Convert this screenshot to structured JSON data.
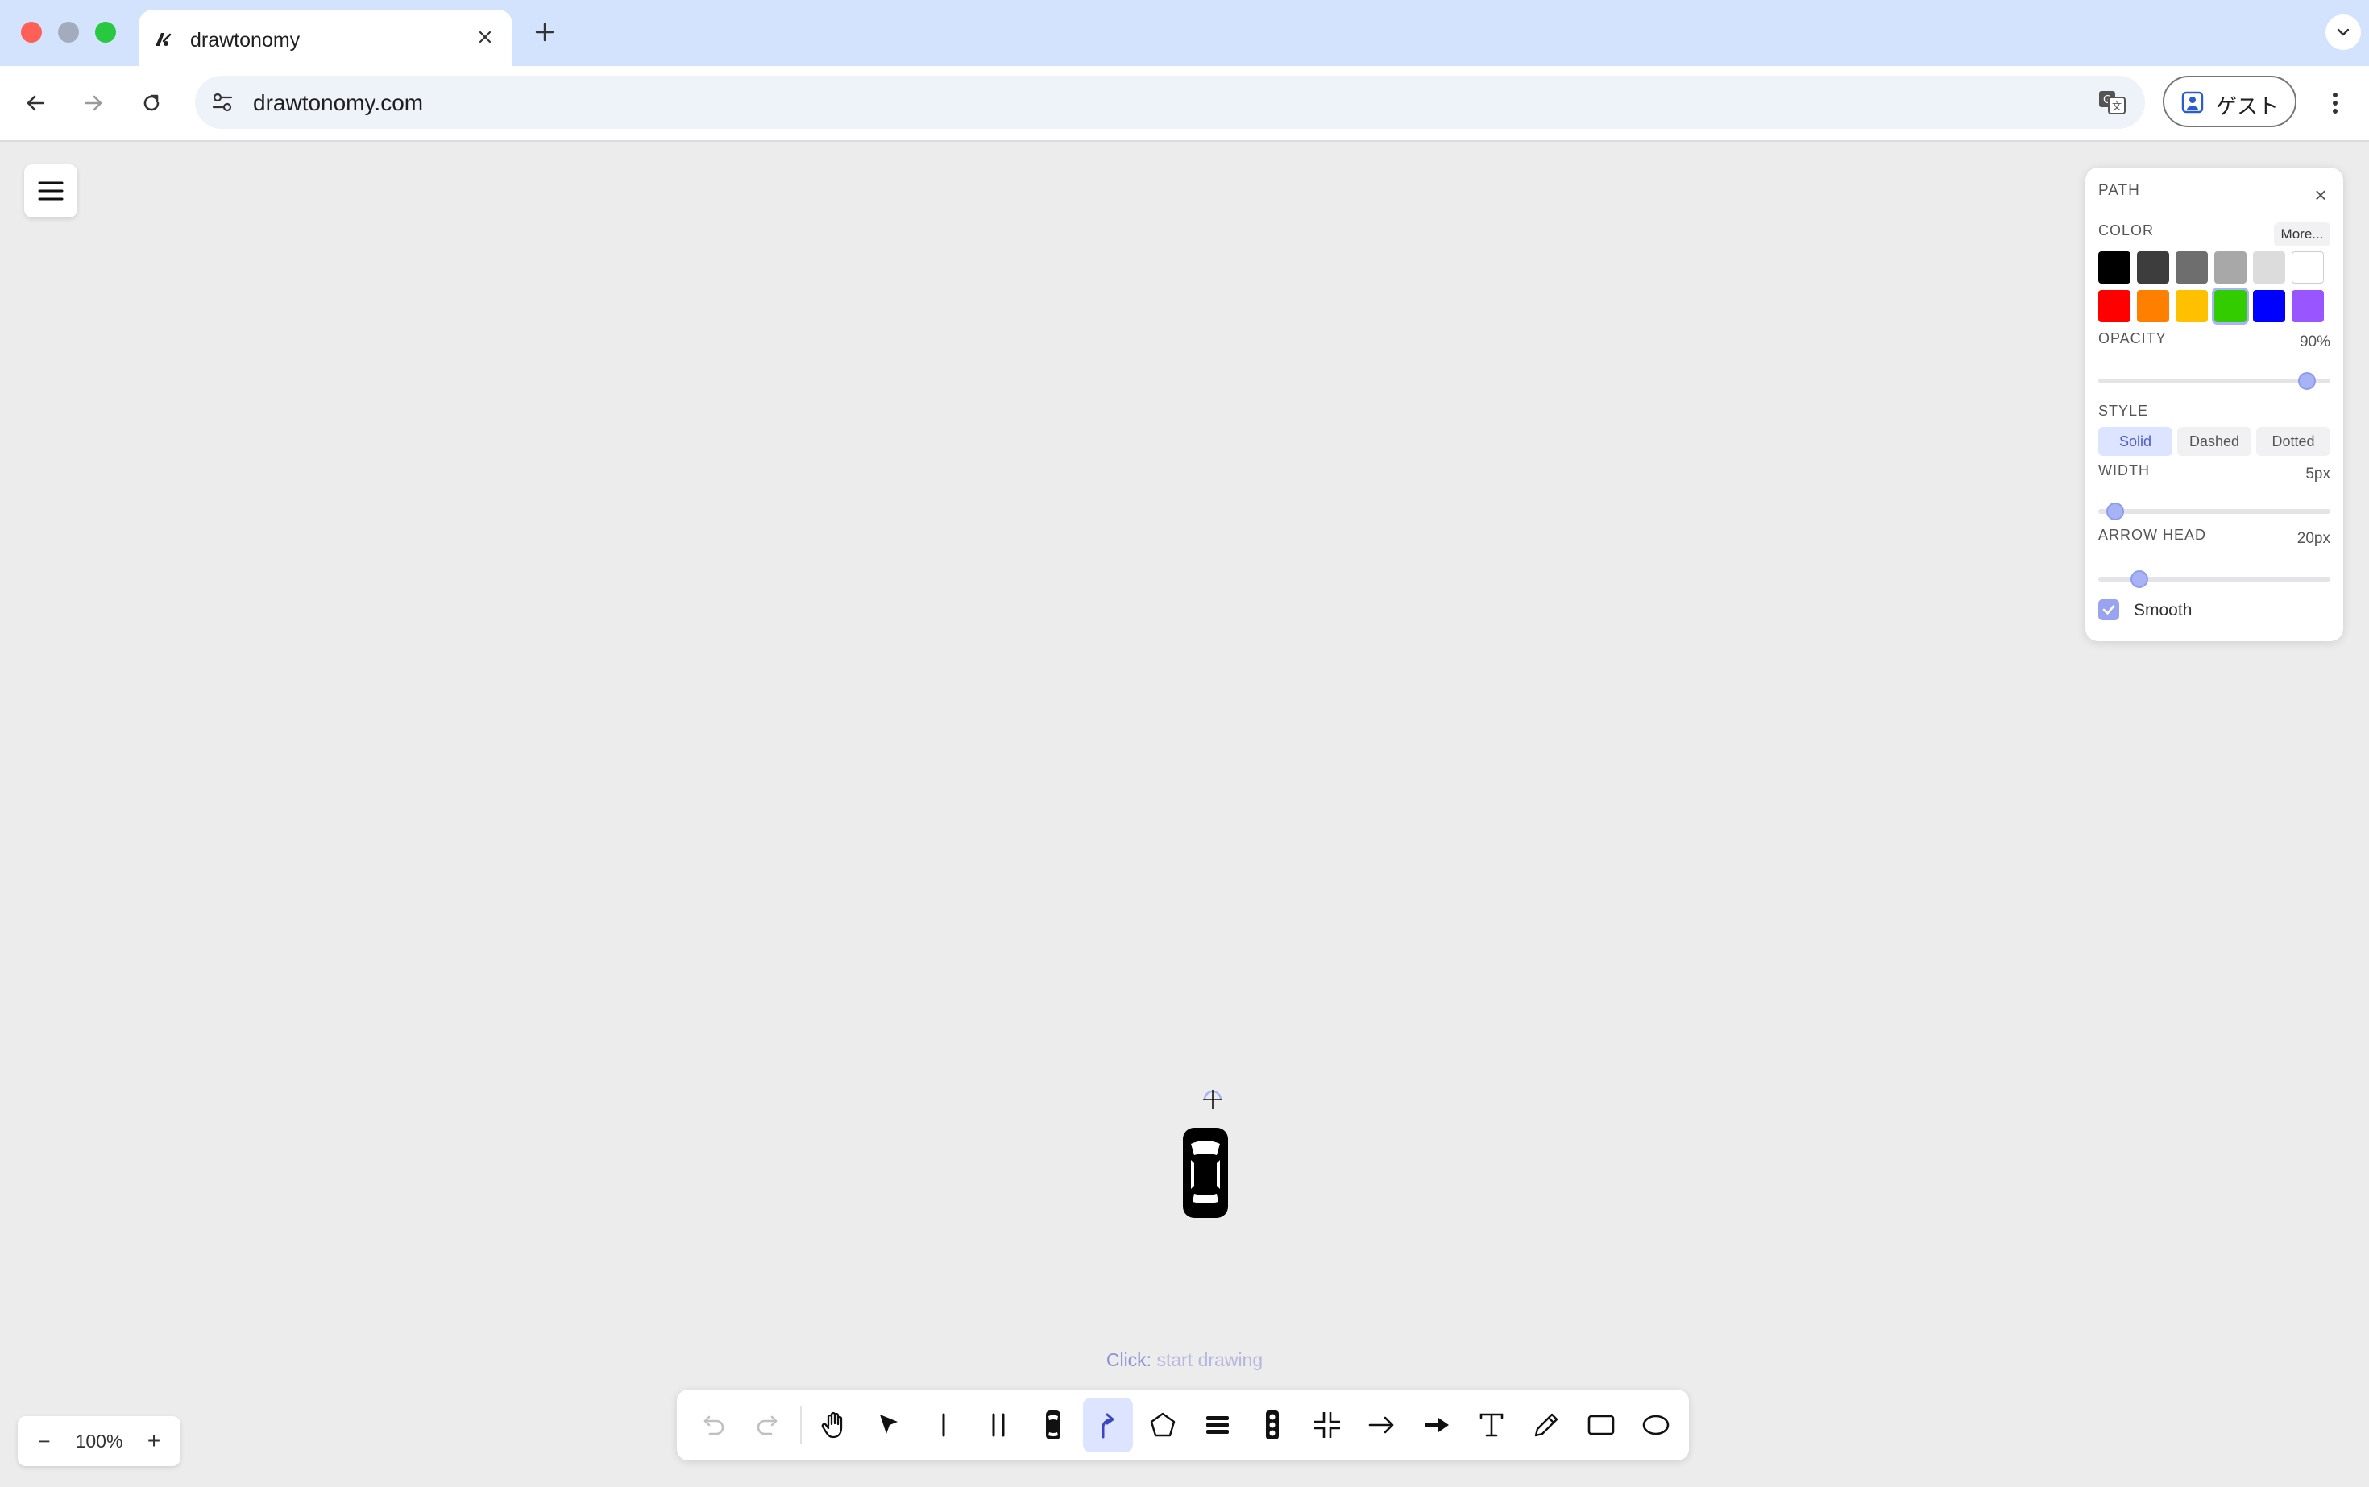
{
  "browser": {
    "tab_title": "drawtonomy",
    "url": "drawtonomy.com",
    "profile_label": "ゲスト"
  },
  "canvas": {
    "hint_action": "Click:",
    "hint_text": "start drawing"
  },
  "zoom": {
    "value": "100%",
    "minus": "−",
    "plus": "+"
  },
  "panel": {
    "title": "PATH",
    "close": "×",
    "color_label": "COLOR",
    "more_label": "More...",
    "colors": [
      "#000000",
      "#3d3d3d",
      "#6e6e6e",
      "#a8a8a8",
      "#dcdcdc",
      "#ffffff",
      "#ff0000",
      "#ff7f00",
      "#ffc000",
      "#33cc00",
      "#0000ff",
      "#9955ff"
    ],
    "selected_color": "#33cc00",
    "opacity_label": "OPACITY",
    "opacity_value": "90%",
    "opacity_fraction": 0.9,
    "style_label": "STYLE",
    "style_options": [
      "Solid",
      "Dashed",
      "Dotted"
    ],
    "style_selected": "Solid",
    "width_label": "WIDTH",
    "width_value": "5px",
    "arrow_head_label": "ARROW HEAD",
    "arrow_head_value": "20px",
    "smooth_label": "Smooth",
    "smooth_checked": true,
    "accent_color": "#a7b3f5"
  },
  "toolbar": {
    "tools": [
      "undo",
      "redo",
      "pan",
      "select",
      "lane-line",
      "double-lane-line",
      "car",
      "path",
      "polygon",
      "crosswalk",
      "traffic-light",
      "intersection",
      "arrow",
      "thick-arrow",
      "text",
      "pencil",
      "rectangle",
      "ellipse"
    ],
    "active_tool": "path"
  }
}
